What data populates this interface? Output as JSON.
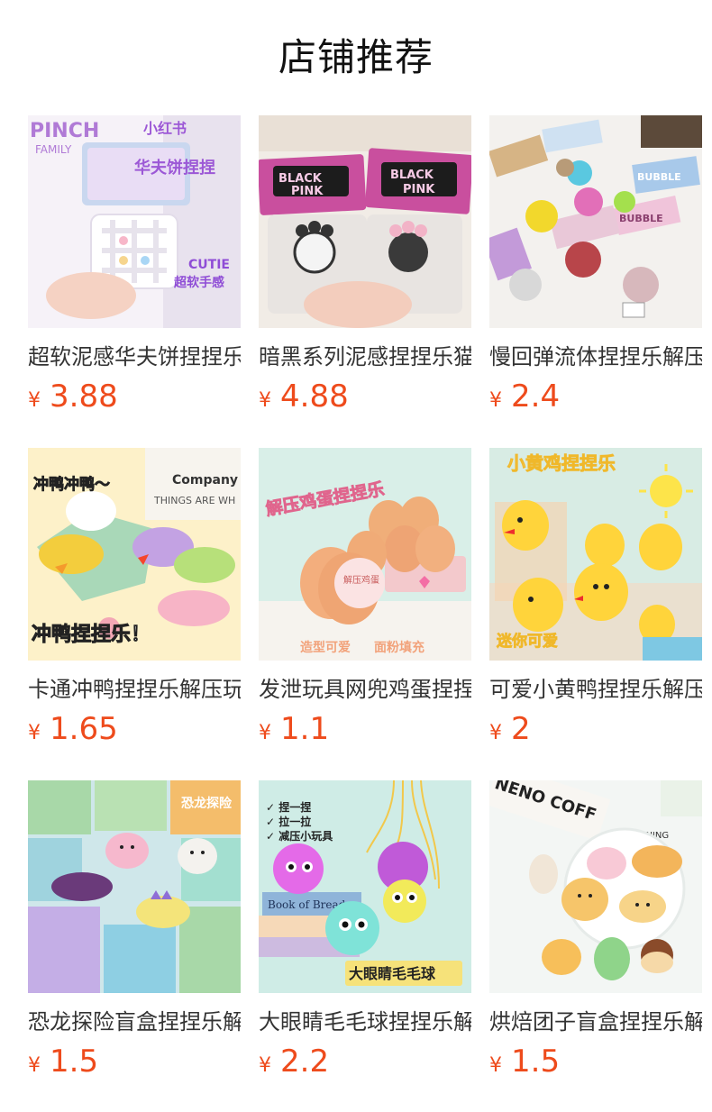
{
  "header": {
    "title": "店铺推荐"
  },
  "products": [
    {
      "name": "超软泥感华夫饼捏捏乐解压玩具",
      "currency": "¥",
      "price": "3.88",
      "image": {
        "bg": "#efe7f4",
        "texts": [
          "PINCH",
          "FAMILY",
          "小红书",
          "华夫饼捏捏",
          "CUTIE",
          "超软手感"
        ]
      }
    },
    {
      "name": "暗黑系列泥感捏捏乐猫爪解压",
      "currency": "¥",
      "price": "4.88",
      "image": {
        "bg": "#f1ece6",
        "texts": [
          "BLACK",
          "PINK",
          "BLACK",
          "PINK"
        ]
      }
    },
    {
      "name": "慢回弹流体捏捏乐解压玩具",
      "currency": "¥",
      "price": "2.4",
      "image": {
        "bg": "#f3f1ee",
        "texts": [
          "BUBBLE",
          "BUBBLE"
        ]
      }
    },
    {
      "name": "卡通冲鸭捏捏乐解压玩具",
      "currency": "¥",
      "price": "1.65",
      "image": {
        "bg": "#fdf1c9",
        "texts": [
          "冲鸭冲鸭～",
          "冲鸭捏捏乐！",
          "Company",
          "THINGS ARE WH"
        ]
      }
    },
    {
      "name": "发泄玩具网兜鸡蛋捏捏乐",
      "currency": "¥",
      "price": "1.1",
      "image": {
        "bg": "#d9efe8",
        "texts": [
          "解压鸡蛋捏捏乐",
          "造型可爱",
          "面粉填充",
          "解压鸡蛋"
        ]
      }
    },
    {
      "name": "可爱小黄鸭捏捏乐解压玩具",
      "currency": "¥",
      "price": "2",
      "image": {
        "bg": "#d8ece4",
        "texts": [
          "小黄鸡捏捏乐",
          "迷你可爱"
        ]
      }
    },
    {
      "name": "恐龙探险盲盒捏捏乐解压",
      "currency": "¥",
      "price": "1.5",
      "image": {
        "bg": "#cfe7ea",
        "texts": [
          "恐龙探险"
        ]
      }
    },
    {
      "name": "大眼睛毛毛球捏捏乐解压",
      "currency": "¥",
      "price": "2.2",
      "image": {
        "bg": "#cfece6",
        "texts": [
          "✓ 捏一捏",
          "✓ 拉一拉",
          "✓ 减压小玩具",
          "Book of Bread",
          "大眼睛毛毛球"
        ]
      }
    },
    {
      "name": "烘焙团子盲盒捏捏乐解压",
      "currency": "¥",
      "price": "1.5",
      "image": {
        "bg": "#f3f6f4",
        "texts": [
          "NENO COFF",
          "MORNING"
        ]
      }
    }
  ],
  "colors": {
    "price": "#ee4b1c",
    "name": "#333333",
    "title": "#111111"
  }
}
